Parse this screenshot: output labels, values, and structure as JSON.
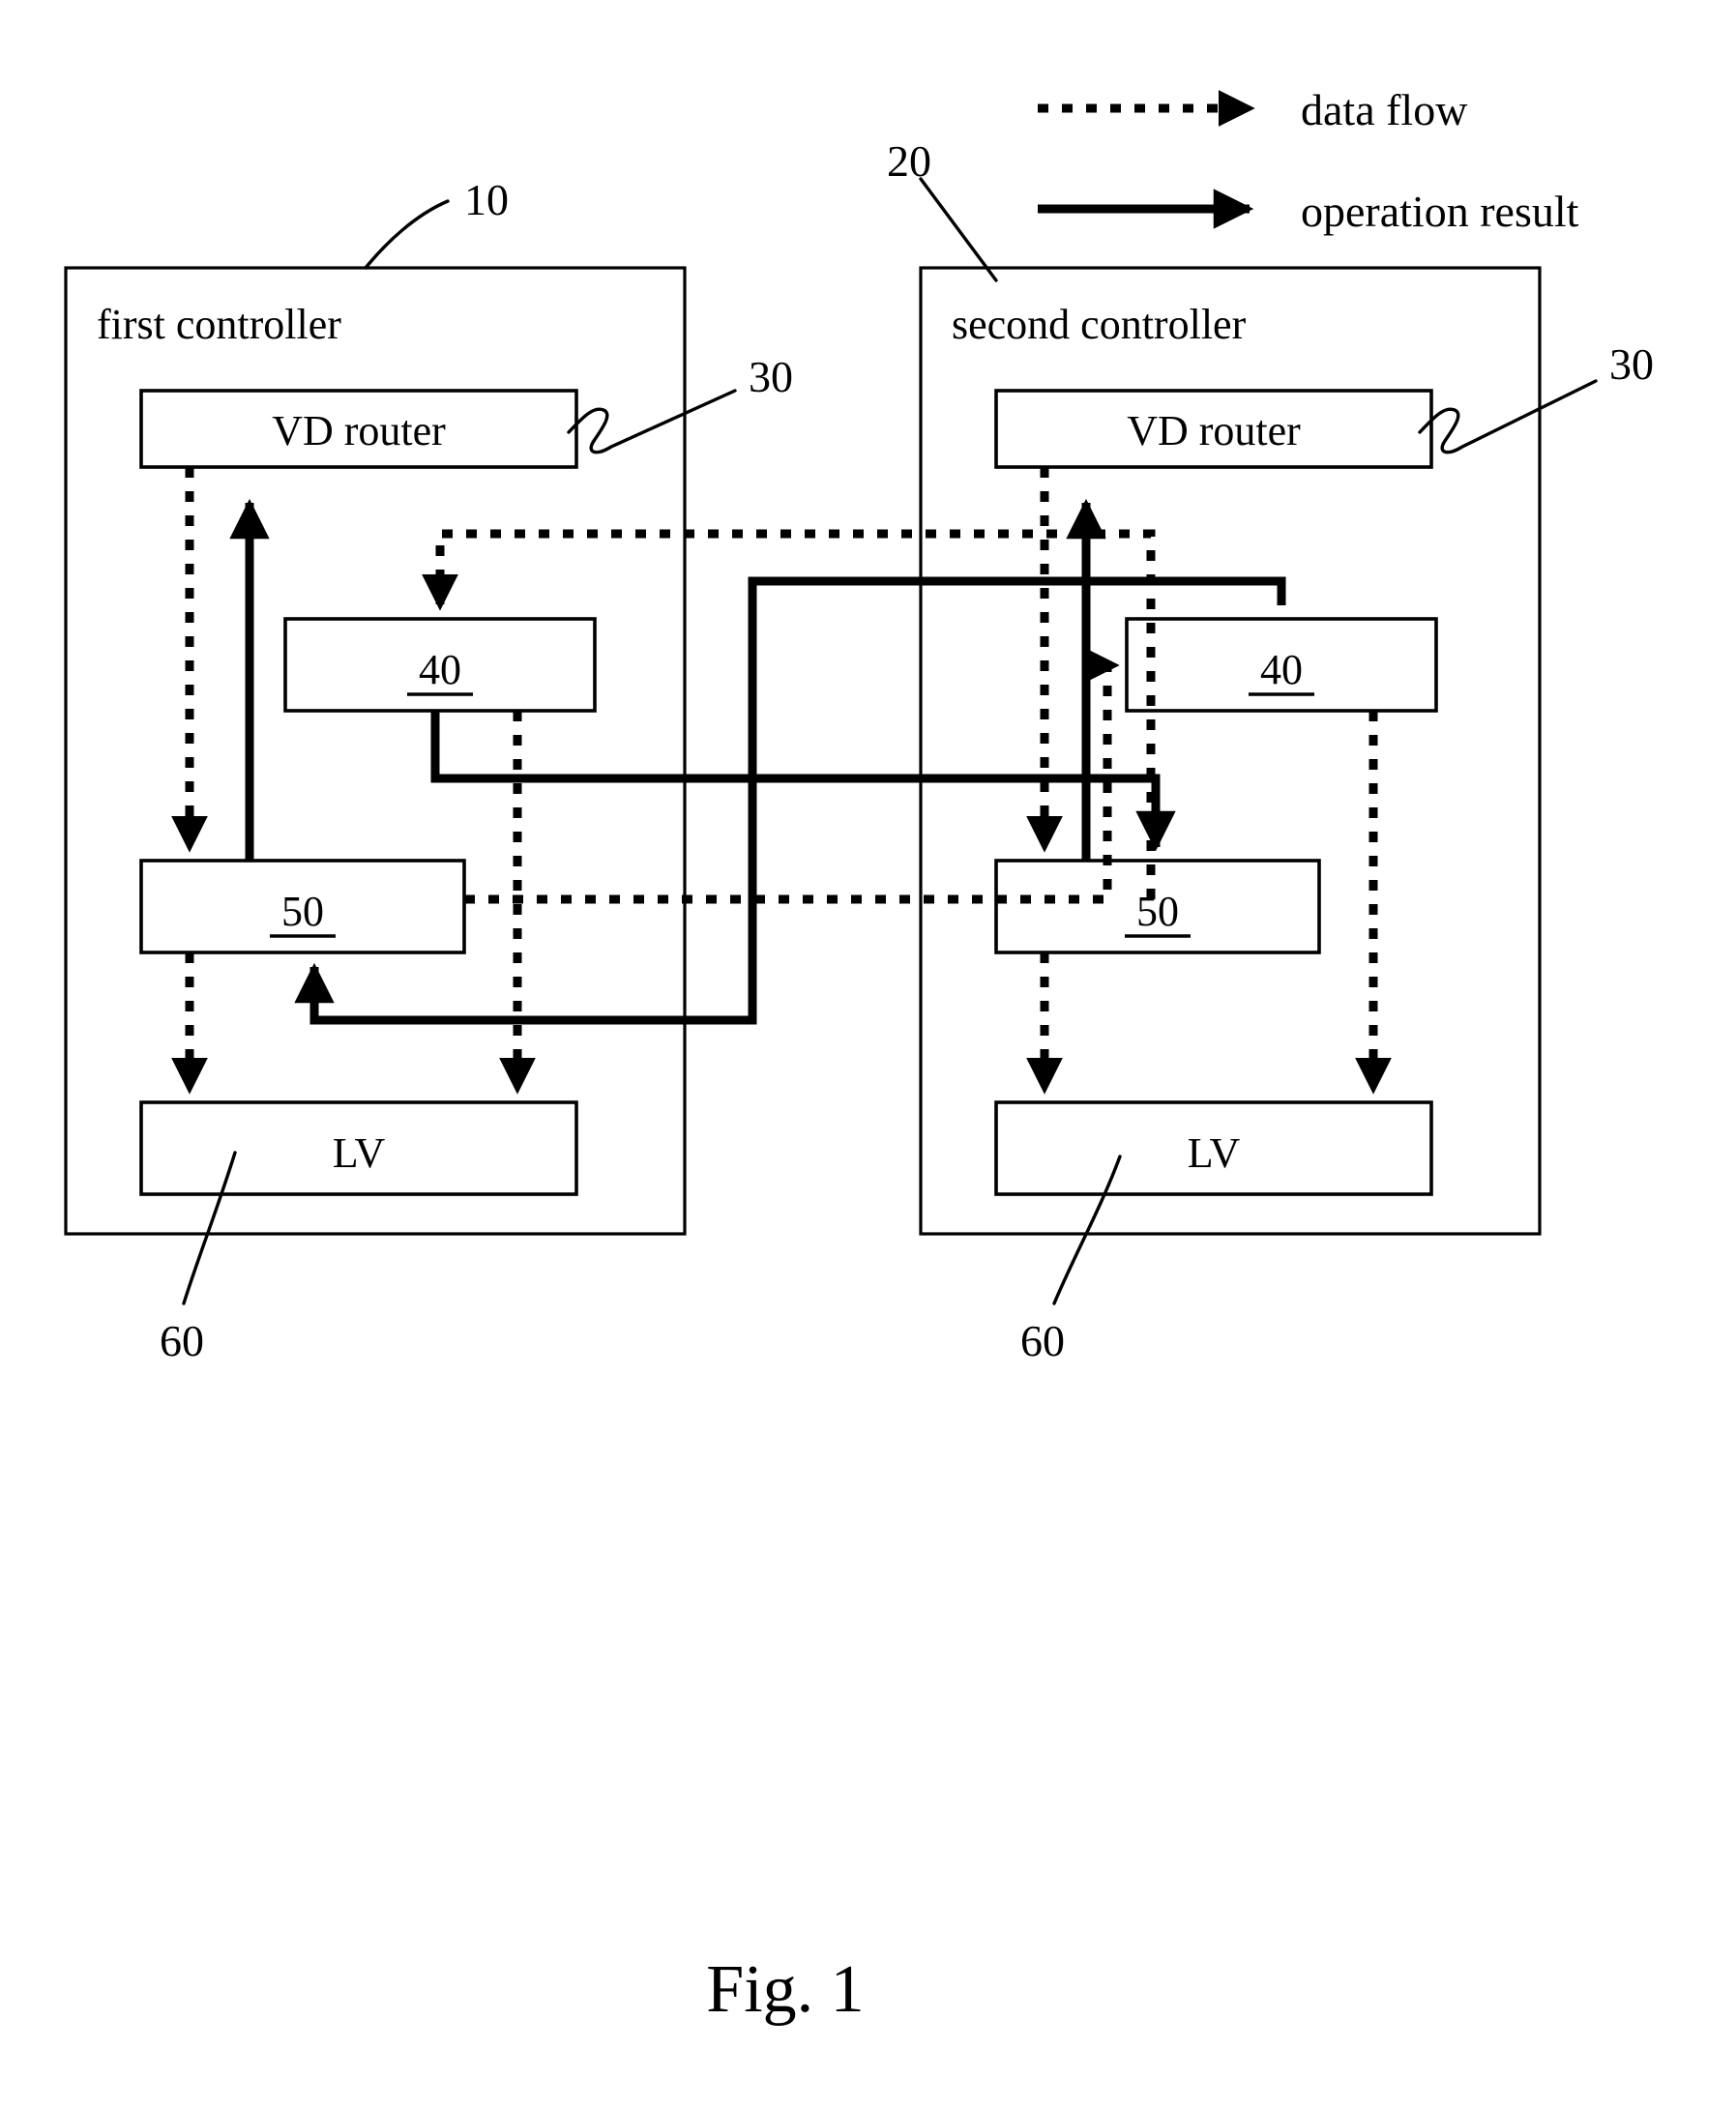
{
  "figure": {
    "caption": "Fig. 1"
  },
  "legend": {
    "items": [
      {
        "label": "data flow",
        "style": "dotted-arrow"
      },
      {
        "label": "operation result",
        "style": "solid-arrow"
      }
    ]
  },
  "controllers": [
    {
      "id": "first",
      "title": "first controller",
      "ref": "10",
      "blocks": [
        {
          "name": "vd-router",
          "label": "VD router",
          "ref": "30"
        },
        {
          "name": "block-40",
          "label": "40",
          "underlined": true
        },
        {
          "name": "block-50",
          "label": "50",
          "underlined": true
        },
        {
          "name": "lv",
          "label": "LV",
          "ref": "60"
        }
      ]
    },
    {
      "id": "second",
      "title": "second controller",
      "ref": "20",
      "blocks": [
        {
          "name": "vd-router",
          "label": "VD router",
          "ref": "30"
        },
        {
          "name": "block-40",
          "label": "40",
          "underlined": true
        },
        {
          "name": "block-50",
          "label": "50",
          "underlined": true
        },
        {
          "name": "lv",
          "label": "LV",
          "ref": "60"
        }
      ]
    }
  ],
  "reference_numerals": {
    "first_controller": "10",
    "second_controller": "20",
    "vd_router_left": "30",
    "vd_router_right": "30",
    "lv_left": "60",
    "lv_right": "60",
    "block_40": "40",
    "block_50": "50"
  },
  "colors": {
    "stroke": "#000000",
    "background": "#ffffff"
  }
}
